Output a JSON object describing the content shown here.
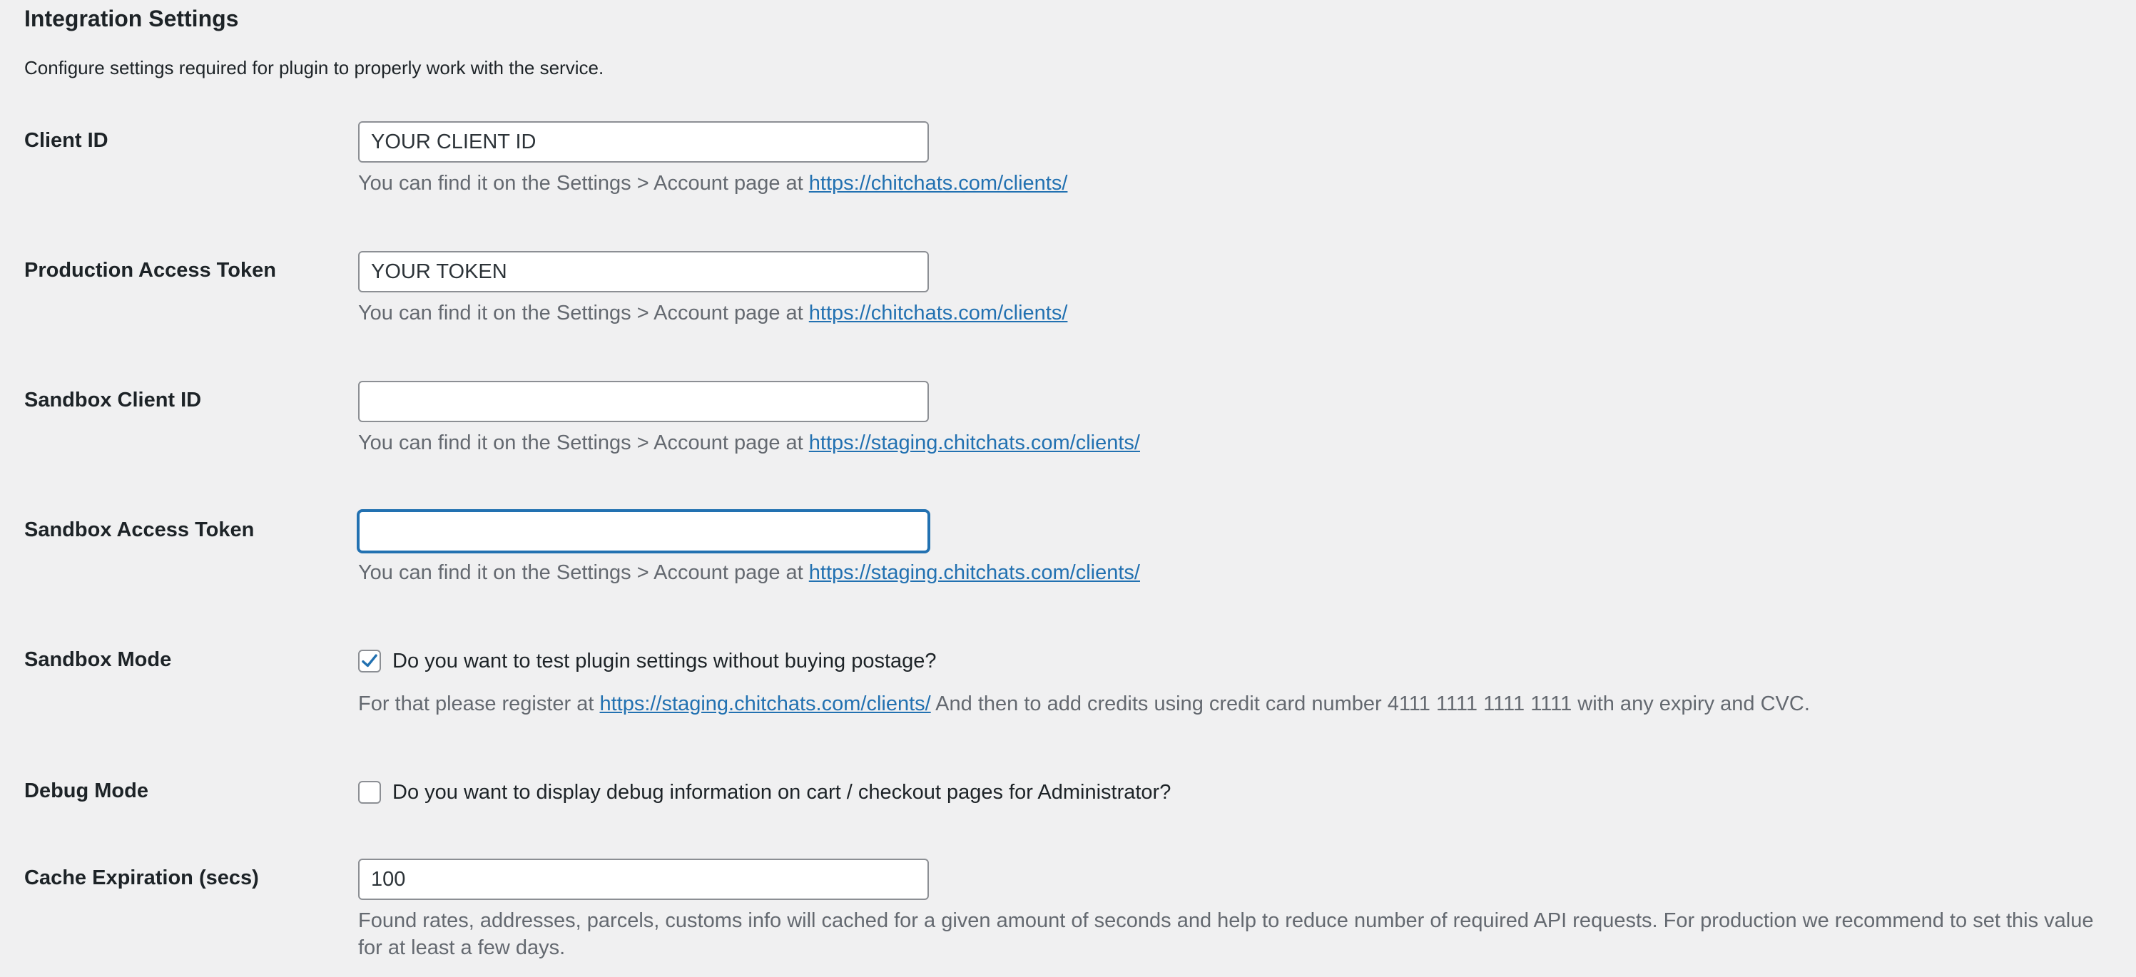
{
  "section": {
    "title": "Integration Settings",
    "description": "Configure settings required for plugin to properly work with the service."
  },
  "fields": {
    "client_id": {
      "label": "Client ID",
      "value": "YOUR CLIENT ID",
      "help_prefix": "You can find it on the Settings > Account page at ",
      "help_link": "https://chitchats.com/clients/"
    },
    "production_token": {
      "label": "Production Access Token",
      "value": "YOUR TOKEN",
      "help_prefix": "You can find it on the Settings > Account page at ",
      "help_link": "https://chitchats.com/clients/"
    },
    "sandbox_client_id": {
      "label": "Sandbox Client ID",
      "value": "",
      "help_prefix": "You can find it on the Settings > Account page at ",
      "help_link": "https://staging.chitchats.com/clients/"
    },
    "sandbox_token": {
      "label": "Sandbox Access Token",
      "value": "",
      "help_prefix": "You can find it on the Settings > Account page at ",
      "help_link": "https://staging.chitchats.com/clients/"
    },
    "sandbox_mode": {
      "label": "Sandbox Mode",
      "checked": true,
      "checkbox_label": "Do you want to test plugin settings without buying postage?",
      "help_prefix": "For that please register at ",
      "help_link": "https://staging.chitchats.com/clients/",
      "help_suffix": " And then to add credits using credit card number 4111 1111 1111 1111 with any expiry and CVC."
    },
    "debug_mode": {
      "label": "Debug Mode",
      "checked": false,
      "checkbox_label": "Do you want to display debug information on cart / checkout pages for Administrator?"
    },
    "cache_expiration": {
      "label": "Cache Expiration (secs)",
      "value": "100",
      "help": "Found rates, addresses, parcels, customs info will cached for a given amount of seconds and help to reduce number of required API requests. For production we recommend to set this value for at least a few days."
    }
  },
  "colors": {
    "link": "#2271b1",
    "background": "#f0f0f1",
    "help_text": "#646970",
    "focus": "#2271b1"
  },
  "icons": {
    "checkmark": "checkmark-icon"
  }
}
